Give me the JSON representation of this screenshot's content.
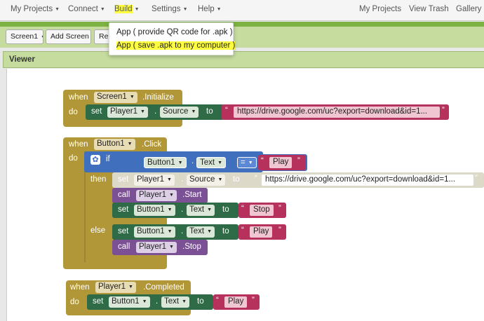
{
  "topbar": {
    "menus": [
      {
        "label": "My Projects"
      },
      {
        "label": "Connect"
      },
      {
        "label": "Build"
      },
      {
        "label": "Settings"
      },
      {
        "label": "Help"
      }
    ],
    "right": [
      "My Projects",
      "View Trash",
      "Gallery"
    ]
  },
  "build_dropdown": {
    "items": [
      "App ( provide QR code for .apk )",
      "App ( save .apk to my computer )"
    ]
  },
  "toolbar": {
    "screen_select": "Screen1",
    "add_screen": "Add Screen ...",
    "remove_screen": "Rem"
  },
  "viewer": {
    "title": "Viewer"
  },
  "blocks": {
    "when": "when",
    "do": "do",
    "set": "set",
    "to": "to",
    "call": "call",
    "if": "if",
    "then": "then",
    "else": "else",
    "dot": ".",
    "b1": {
      "component": "Screen1",
      "event": ".Initialize",
      "target": "Player1",
      "prop": "Source",
      "url": "https://drive.google.com/uc?export=download&id=1..."
    },
    "b2": {
      "component": "Button1",
      "event": ".Click",
      "cmp_left": "Button1",
      "cmp_prop": "Text",
      "op": "=",
      "cmp_right": "Play",
      "then_set_target": "Player1",
      "then_set_prop": "Source",
      "then_url": "https://drive.google.com/uc?export=download&id=1...",
      "call1_target": "Player1",
      "call1_method": ".Start",
      "set2_target": "Button1",
      "set2_prop": "Text",
      "set2_value": "Stop",
      "else_set_target": "Button1",
      "else_set_prop": "Text",
      "else_set_value": "Play",
      "else_call_target": "Player1",
      "else_call_method": ".Stop"
    },
    "b3": {
      "component": "Player1",
      "event": ".Completed",
      "target": "Button1",
      "prop": "Text",
      "value": "Play"
    }
  },
  "quote": "“",
  "quote_close": "”"
}
